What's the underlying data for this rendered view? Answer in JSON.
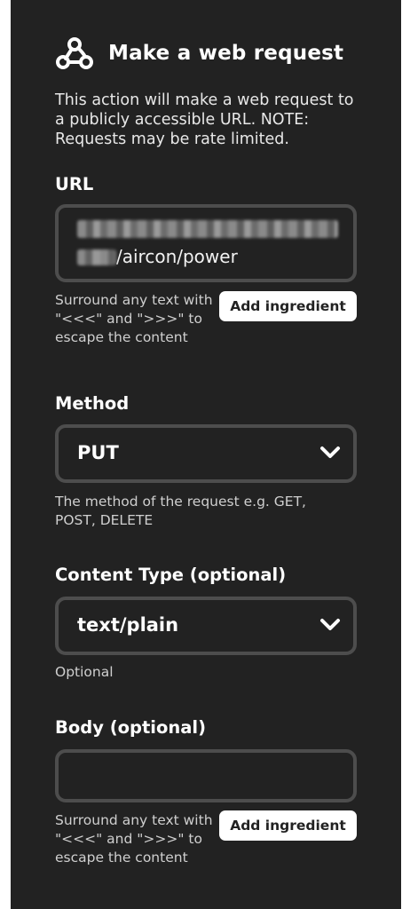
{
  "header": {
    "icon": "webhook-icon",
    "title": "Make a web request",
    "description": "This action will make a web request to a publicly accessible URL. NOTE: Requests may be rate limited."
  },
  "url": {
    "label": "URL",
    "value_visible_suffix": "/aircon/power",
    "help": "Surround any text with \"<<<\" and \">>>\" to escape the content",
    "add_ingredient": "Add ingredient"
  },
  "method": {
    "label": "Method",
    "value": "PUT",
    "help": "The method of the request e.g. GET, POST, DELETE"
  },
  "content_type": {
    "label": "Content Type (optional)",
    "value": "text/plain",
    "help": "Optional"
  },
  "body": {
    "label": "Body (optional)",
    "value": "",
    "help": "Surround any text with \"<<<\" and \">>>\" to escape the content",
    "add_ingredient": "Add ingredient"
  },
  "colors": {
    "panel_bg": "#222222",
    "field_border": "#4d4d4d",
    "text": "#ffffff",
    "help_text": "#cfcfcf",
    "button_bg": "#ffffff"
  }
}
